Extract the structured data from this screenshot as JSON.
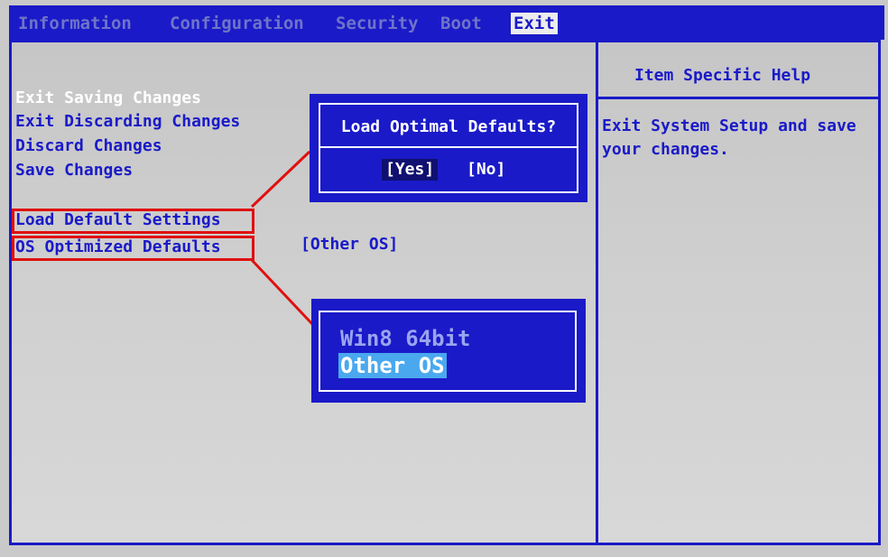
{
  "menubar": {
    "tabs": [
      {
        "label": "Information"
      },
      {
        "label": "Configuration"
      },
      {
        "label": "Security"
      },
      {
        "label": "Boot"
      },
      {
        "label": "Exit"
      }
    ],
    "active_tab": "Exit"
  },
  "exit_menu": {
    "items": [
      {
        "label": "Exit Saving Changes"
      },
      {
        "label": "Exit Discarding Changes"
      },
      {
        "label": "Discard Changes"
      },
      {
        "label": "Save Changes"
      },
      {
        "label": "Load Default Settings"
      },
      {
        "label": "OS Optimized Defaults"
      }
    ],
    "os_optimized_value": "[Other OS]"
  },
  "help_panel": {
    "title": "Item Specific Help",
    "text": "Exit System Setup and save your changes."
  },
  "load_defaults_dialog": {
    "title": "Load Optimal Defaults?",
    "yes_label": "[Yes]",
    "no_label": "[No]"
  },
  "os_select_popup": {
    "options": [
      {
        "label": "Win8 64bit"
      },
      {
        "label": "Other OS"
      }
    ],
    "selected": "Other OS"
  },
  "colors": {
    "bios_blue": "#1a1ac8",
    "annotation_red": "#e01010",
    "selection_cyan": "#4aa8ee"
  }
}
